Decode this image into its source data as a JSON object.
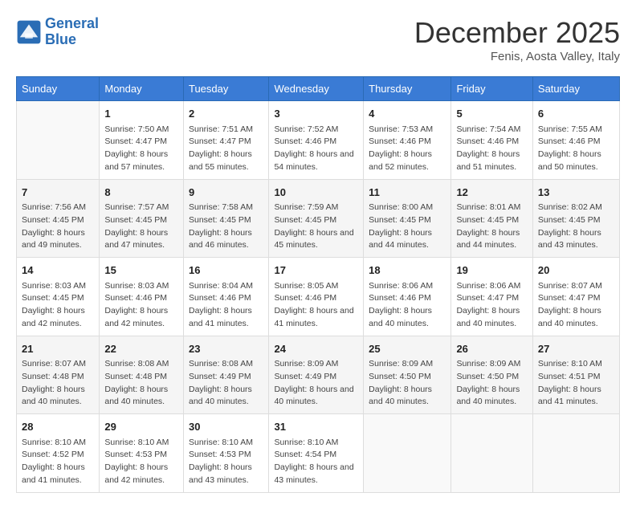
{
  "header": {
    "logo_line1": "General",
    "logo_line2": "Blue",
    "month_title": "December 2025",
    "location": "Fenis, Aosta Valley, Italy"
  },
  "days_of_week": [
    "Sunday",
    "Monday",
    "Tuesday",
    "Wednesday",
    "Thursday",
    "Friday",
    "Saturday"
  ],
  "weeks": [
    [
      {
        "day": "",
        "sunrise": "",
        "sunset": "",
        "daylight": ""
      },
      {
        "day": "1",
        "sunrise": "Sunrise: 7:50 AM",
        "sunset": "Sunset: 4:47 PM",
        "daylight": "Daylight: 8 hours and 57 minutes."
      },
      {
        "day": "2",
        "sunrise": "Sunrise: 7:51 AM",
        "sunset": "Sunset: 4:47 PM",
        "daylight": "Daylight: 8 hours and 55 minutes."
      },
      {
        "day": "3",
        "sunrise": "Sunrise: 7:52 AM",
        "sunset": "Sunset: 4:46 PM",
        "daylight": "Daylight: 8 hours and 54 minutes."
      },
      {
        "day": "4",
        "sunrise": "Sunrise: 7:53 AM",
        "sunset": "Sunset: 4:46 PM",
        "daylight": "Daylight: 8 hours and 52 minutes."
      },
      {
        "day": "5",
        "sunrise": "Sunrise: 7:54 AM",
        "sunset": "Sunset: 4:46 PM",
        "daylight": "Daylight: 8 hours and 51 minutes."
      },
      {
        "day": "6",
        "sunrise": "Sunrise: 7:55 AM",
        "sunset": "Sunset: 4:46 PM",
        "daylight": "Daylight: 8 hours and 50 minutes."
      }
    ],
    [
      {
        "day": "7",
        "sunrise": "Sunrise: 7:56 AM",
        "sunset": "Sunset: 4:45 PM",
        "daylight": "Daylight: 8 hours and 49 minutes."
      },
      {
        "day": "8",
        "sunrise": "Sunrise: 7:57 AM",
        "sunset": "Sunset: 4:45 PM",
        "daylight": "Daylight: 8 hours and 47 minutes."
      },
      {
        "day": "9",
        "sunrise": "Sunrise: 7:58 AM",
        "sunset": "Sunset: 4:45 PM",
        "daylight": "Daylight: 8 hours and 46 minutes."
      },
      {
        "day": "10",
        "sunrise": "Sunrise: 7:59 AM",
        "sunset": "Sunset: 4:45 PM",
        "daylight": "Daylight: 8 hours and 45 minutes."
      },
      {
        "day": "11",
        "sunrise": "Sunrise: 8:00 AM",
        "sunset": "Sunset: 4:45 PM",
        "daylight": "Daylight: 8 hours and 44 minutes."
      },
      {
        "day": "12",
        "sunrise": "Sunrise: 8:01 AM",
        "sunset": "Sunset: 4:45 PM",
        "daylight": "Daylight: 8 hours and 44 minutes."
      },
      {
        "day": "13",
        "sunrise": "Sunrise: 8:02 AM",
        "sunset": "Sunset: 4:45 PM",
        "daylight": "Daylight: 8 hours and 43 minutes."
      }
    ],
    [
      {
        "day": "14",
        "sunrise": "Sunrise: 8:03 AM",
        "sunset": "Sunset: 4:45 PM",
        "daylight": "Daylight: 8 hours and 42 minutes."
      },
      {
        "day": "15",
        "sunrise": "Sunrise: 8:03 AM",
        "sunset": "Sunset: 4:46 PM",
        "daylight": "Daylight: 8 hours and 42 minutes."
      },
      {
        "day": "16",
        "sunrise": "Sunrise: 8:04 AM",
        "sunset": "Sunset: 4:46 PM",
        "daylight": "Daylight: 8 hours and 41 minutes."
      },
      {
        "day": "17",
        "sunrise": "Sunrise: 8:05 AM",
        "sunset": "Sunset: 4:46 PM",
        "daylight": "Daylight: 8 hours and 41 minutes."
      },
      {
        "day": "18",
        "sunrise": "Sunrise: 8:06 AM",
        "sunset": "Sunset: 4:46 PM",
        "daylight": "Daylight: 8 hours and 40 minutes."
      },
      {
        "day": "19",
        "sunrise": "Sunrise: 8:06 AM",
        "sunset": "Sunset: 4:47 PM",
        "daylight": "Daylight: 8 hours and 40 minutes."
      },
      {
        "day": "20",
        "sunrise": "Sunrise: 8:07 AM",
        "sunset": "Sunset: 4:47 PM",
        "daylight": "Daylight: 8 hours and 40 minutes."
      }
    ],
    [
      {
        "day": "21",
        "sunrise": "Sunrise: 8:07 AM",
        "sunset": "Sunset: 4:48 PM",
        "daylight": "Daylight: 8 hours and 40 minutes."
      },
      {
        "day": "22",
        "sunrise": "Sunrise: 8:08 AM",
        "sunset": "Sunset: 4:48 PM",
        "daylight": "Daylight: 8 hours and 40 minutes."
      },
      {
        "day": "23",
        "sunrise": "Sunrise: 8:08 AM",
        "sunset": "Sunset: 4:49 PM",
        "daylight": "Daylight: 8 hours and 40 minutes."
      },
      {
        "day": "24",
        "sunrise": "Sunrise: 8:09 AM",
        "sunset": "Sunset: 4:49 PM",
        "daylight": "Daylight: 8 hours and 40 minutes."
      },
      {
        "day": "25",
        "sunrise": "Sunrise: 8:09 AM",
        "sunset": "Sunset: 4:50 PM",
        "daylight": "Daylight: 8 hours and 40 minutes."
      },
      {
        "day": "26",
        "sunrise": "Sunrise: 8:09 AM",
        "sunset": "Sunset: 4:50 PM",
        "daylight": "Daylight: 8 hours and 40 minutes."
      },
      {
        "day": "27",
        "sunrise": "Sunrise: 8:10 AM",
        "sunset": "Sunset: 4:51 PM",
        "daylight": "Daylight: 8 hours and 41 minutes."
      }
    ],
    [
      {
        "day": "28",
        "sunrise": "Sunrise: 8:10 AM",
        "sunset": "Sunset: 4:52 PM",
        "daylight": "Daylight: 8 hours and 41 minutes."
      },
      {
        "day": "29",
        "sunrise": "Sunrise: 8:10 AM",
        "sunset": "Sunset: 4:53 PM",
        "daylight": "Daylight: 8 hours and 42 minutes."
      },
      {
        "day": "30",
        "sunrise": "Sunrise: 8:10 AM",
        "sunset": "Sunset: 4:53 PM",
        "daylight": "Daylight: 8 hours and 43 minutes."
      },
      {
        "day": "31",
        "sunrise": "Sunrise: 8:10 AM",
        "sunset": "Sunset: 4:54 PM",
        "daylight": "Daylight: 8 hours and 43 minutes."
      },
      {
        "day": "",
        "sunrise": "",
        "sunset": "",
        "daylight": ""
      },
      {
        "day": "",
        "sunrise": "",
        "sunset": "",
        "daylight": ""
      },
      {
        "day": "",
        "sunrise": "",
        "sunset": "",
        "daylight": ""
      }
    ]
  ]
}
